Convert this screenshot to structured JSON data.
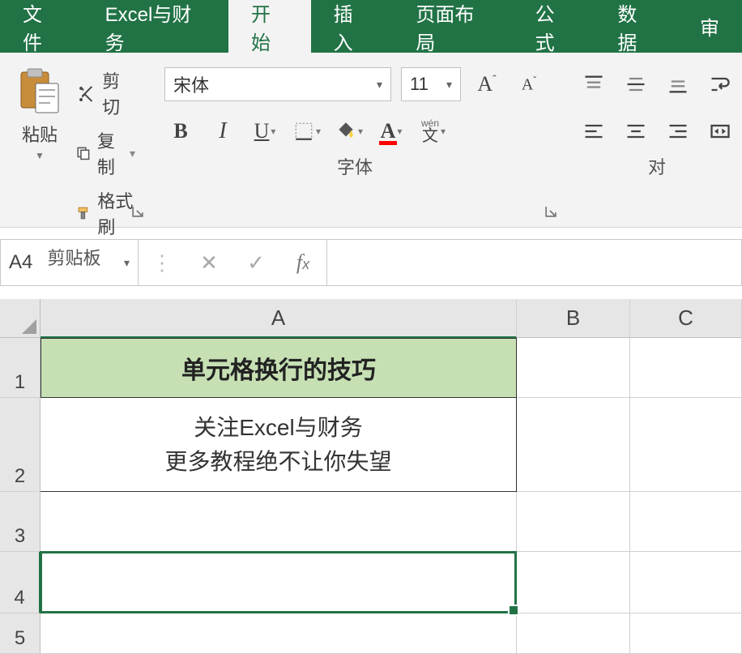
{
  "tabs": {
    "file": "文件",
    "custom": "Excel与财务",
    "home": "开始",
    "insert": "插入",
    "layout": "页面布局",
    "formulas": "公式",
    "data": "数据",
    "review": "审"
  },
  "ribbon": {
    "clipboard": {
      "paste": "粘贴",
      "cut": "剪切",
      "copy": "复制",
      "format_painter": "格式刷",
      "label": "剪贴板"
    },
    "font": {
      "font_name": "宋体",
      "font_size": "11",
      "label": "字体",
      "wen": "wén",
      "wen_char": "文"
    },
    "alignment": {
      "label": "对"
    }
  },
  "name_box": "A4",
  "formula_value": "",
  "columns": [
    "A",
    "B",
    "C"
  ],
  "rows": [
    "1",
    "2",
    "3",
    "4",
    "5"
  ],
  "cells": {
    "A1": "单元格换行的技巧",
    "A2_line1": "关注Excel与财务",
    "A2_line2": "更多教程绝不让你失望"
  }
}
